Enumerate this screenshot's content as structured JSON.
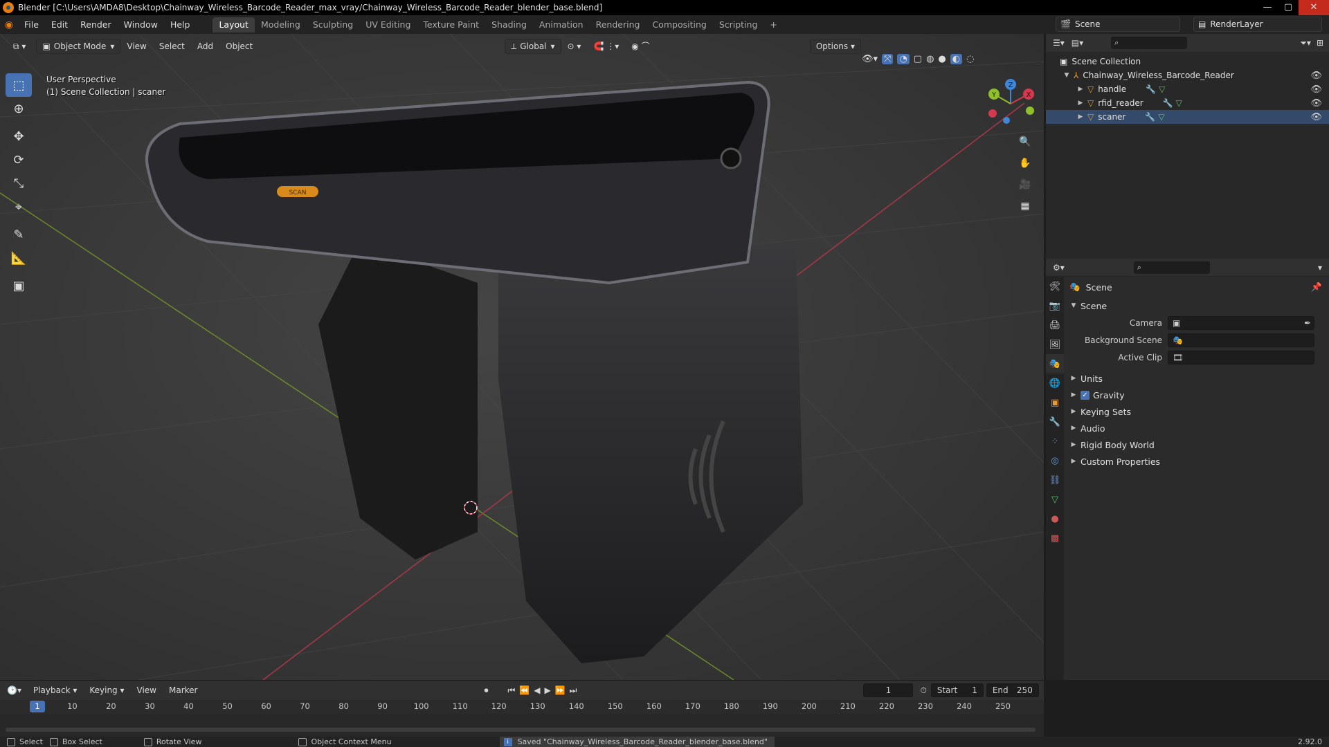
{
  "window": {
    "title": "Blender [C:\\Users\\AMDA8\\Desktop\\Chainway_Wireless_Barcode_Reader_max_vray/Chainway_Wireless_Barcode_Reader_blender_base.blend]",
    "minimize": "—",
    "maximize": "▢",
    "close": "✕"
  },
  "menu": [
    "File",
    "Edit",
    "Render",
    "Window",
    "Help"
  ],
  "workspaces": [
    "Layout",
    "Modeling",
    "Sculpting",
    "UV Editing",
    "Texture Paint",
    "Shading",
    "Animation",
    "Rendering",
    "Compositing",
    "Scripting",
    "+"
  ],
  "active_workspace": "Layout",
  "scene_selector": {
    "value": "Scene"
  },
  "viewlayer_selector": {
    "value": "RenderLayer"
  },
  "viewport": {
    "mode": "Object Mode",
    "menus": [
      "View",
      "Select",
      "Add",
      "Object"
    ],
    "transform_orientation": "Global",
    "options_label": "Options",
    "overlay_text": {
      "line1": "User Perspective",
      "line2": "(1) Scene Collection | scaner"
    },
    "label_scan": "SCAN",
    "gizmo": {
      "x": "X",
      "y": "Y",
      "z": "Z"
    }
  },
  "outliner": {
    "search_placeholder": "",
    "root": "Scene Collection",
    "collection": "Chainway_Wireless_Barcode_Reader",
    "objects": [
      "handle",
      "rfid_reader",
      "scaner"
    ]
  },
  "properties": {
    "breadcrumb": "Scene",
    "panel_title": "Scene",
    "fields": [
      {
        "label": "Camera",
        "value": ""
      },
      {
        "label": "Background Scene",
        "value": ""
      },
      {
        "label": "Active Clip",
        "value": ""
      }
    ],
    "sections": [
      "Units",
      "Gravity",
      "Keying Sets",
      "Audio",
      "Rigid Body World",
      "Custom Properties"
    ],
    "gravity_checked": true
  },
  "timeline": {
    "menus": [
      "Playback",
      "Keying",
      "View",
      "Marker"
    ],
    "current_frame": "1",
    "start_label": "Start",
    "start": "1",
    "end_label": "End",
    "end": "250",
    "ticks": [
      "1",
      "10",
      "20",
      "30",
      "40",
      "50",
      "60",
      "70",
      "80",
      "90",
      "100",
      "110",
      "120",
      "130",
      "140",
      "150",
      "160",
      "170",
      "180",
      "190",
      "200",
      "210",
      "220",
      "230",
      "240",
      "250"
    ]
  },
  "statusbar": {
    "select": "Select",
    "box_select": "Box Select",
    "rotate_view": "Rotate View",
    "context_menu": "Object Context Menu",
    "message": "Saved \"Chainway_Wireless_Barcode_Reader_blender_base.blend\"",
    "version": "2.92.0"
  },
  "colors": {
    "accent": "#4772b3",
    "viewport_bg": "#3c3c3c",
    "x_axis": "#d33a4f",
    "y_axis": "#8fbf2a",
    "z_axis": "#3f87d6"
  }
}
